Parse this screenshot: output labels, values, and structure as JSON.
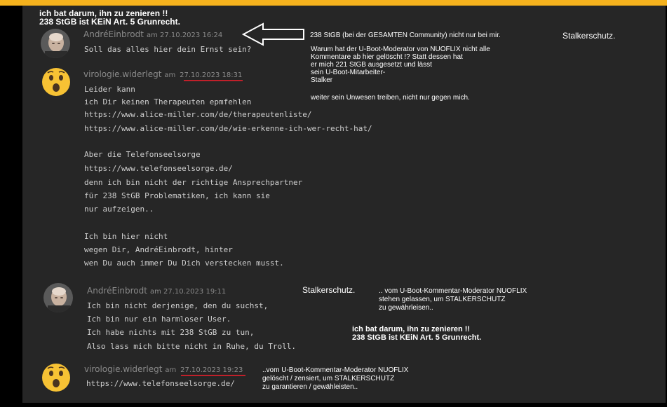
{
  "heading": {
    "line1": "ich bat darum, ihn zu zenieren !!",
    "line2": "238 StGB ist KEiN Art. 5 Grunrecht."
  },
  "comments": [
    {
      "author": "AndréEinbrodt",
      "date": "am 27.10.2023 16:24",
      "avatar": "bald-man-photo",
      "lines": [
        "Soll das alles hier dein Ernst sein?"
      ]
    },
    {
      "author": "virologie.widerlegt",
      "date_prefix": "am",
      "date_main": "27.10.2023 18:31",
      "avatar": "surprised-face-emoji",
      "lines": [
        "Leider kann",
        "ich Dir keinen Therapeuten epmfehlen",
        "https://www.alice-miller.com/de/therapeutenliste/",
        "https://www.alice-miller.com/de/wie-erkenne-ich-wer-recht-hat/",
        "",
        "Aber die Telefonseelsorge",
        "https://www.telefonseelsorge.de/",
        "denn ich bin nicht der richtige Ansprechpartner",
        "für 238 StGB Problematiken, ich kann sie",
        "nur aufzeigen..",
        "",
        "Ich bin hier nicht",
        "wegen Dir, AndréEinbrodt, hinter",
        "wen Du auch immer Du Dich verstecken musst."
      ]
    },
    {
      "author": "AndréEinbrodt",
      "date": "am 27.10.2023 19:11",
      "avatar": "bald-man-photo",
      "lines": [
        "Ich bin nicht derjenige, den du suchst,",
        "Ich bin nur ein harmloser User.",
        "Ich habe nichts mit 238 StGB zu tun,",
        "Also lass mich bitte nicht in Ruhe, du Troll."
      ]
    },
    {
      "author": "virologie.widerlegt",
      "date_prefix": "am",
      "date_main": "27.10.2023 19:23",
      "avatar": "surprised-face-emoji",
      "lines": [
        "https://www.telefonseelsorge.de/"
      ]
    }
  ],
  "annotations": {
    "a1_line1": "238 StGB (bei der GESAMTEN Community) nicht nur bei mir.",
    "a1_stalkerschutz": "Stalkerschutz.",
    "a1_lines": [
      "Warum hat der U-Boot-Moderator von NUOFLIX nicht alle",
      "Kommentare ab hier gelöscht !? Statt dessen hat",
      "er mich 221 StGB ausgesetzt und lässt",
      "sein U-Boot-Mitarbeiter-",
      "Stalker"
    ],
    "a1_last": "weiter sein Unwesen treiben, nicht nur gegen mich.",
    "a2_title": "Stalkerschutz.",
    "a2_lines": [
      ".. vom U-Boot-Kommentar-Moderator NUOFLIX",
      "stehen gelassen, um STALKERSCHUTZ",
      "zu gewährleisen.."
    ],
    "a3_line1": "ich bat darum, ihn zu zenieren !!",
    "a3_line2": "238 StGB ist KEiN Art. 5 Grunrecht.",
    "a4_lines": [
      "..vom U-Boot-Kommentar-Moderator NUOFLIX",
      "gelöscht / zensiert, um STALKERSCHUTZ",
      "zu garantieren / gewähleisten.."
    ]
  },
  "colors": {
    "top_bar": "#f5b21d",
    "panel_bg": "#262626",
    "underline": "#c0202a",
    "arrow": "#ffffff"
  },
  "icons": {
    "arrow": "left-arrow-outline",
    "avatar_man": "bald-man-photo",
    "avatar_emoji": "surprised-face-emoji"
  }
}
